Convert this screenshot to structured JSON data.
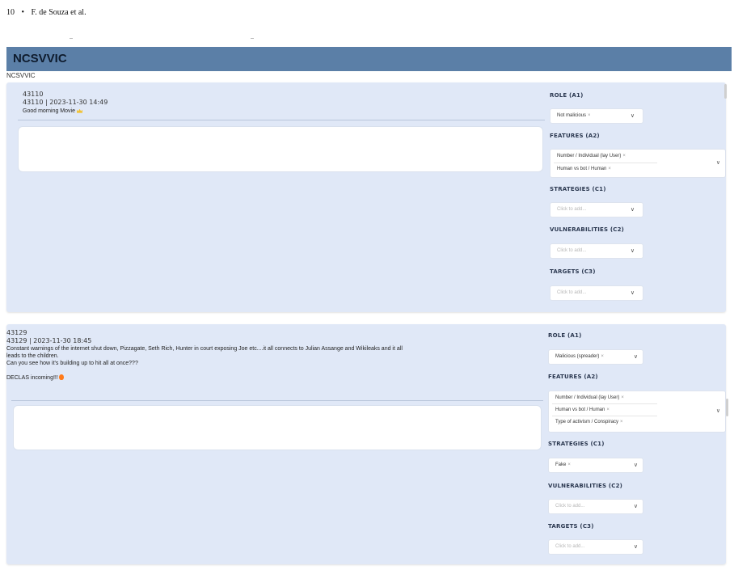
{
  "page_header": {
    "page_number": "10",
    "bullet": "•",
    "authors": "F. de Souza et al."
  },
  "app": {
    "title": "NCSVVIC",
    "subtitle": "NCSVVIC"
  },
  "field_labels": {
    "role": "ROLE (A1)",
    "features": "FEATURES (A2)",
    "strategies": "STRATEGIES (C1)",
    "vulnerabilities": "VULNERABILITIES (C2)",
    "targets": "TARGETS (C3)"
  },
  "placeholder": "Click to add...",
  "remove_glyph": "×",
  "chevron_glyph": "∨",
  "items": [
    {
      "id": "43110",
      "meta": "43110 | 2023-11-30 14:49",
      "text": "Good morning Movie",
      "comment": "",
      "role": "Not malicious",
      "features": [
        "Number / Individual (lay User)",
        "Human vs bot / Human"
      ],
      "strategies": [],
      "vulnerabilities": [],
      "targets": []
    },
    {
      "id": "43129",
      "meta": "43129 | 2023-11-30 18:45",
      "text": "Constant warnings of the internet shut down, Pizzagate, Seth Rich, Hunter in court exposing Joe etc....it all connects to Julian Assange and Wikileaks and it all\nleads to the children.\nCan you see how it's building up to hit all at once???\n\nDECLAS incoming!!!",
      "comment": "",
      "role": "Malicious (spreader)",
      "features": [
        "Number / Individual (lay User)",
        "Human vs bot / Human",
        "Type of activism / Conspiracy"
      ],
      "strategies": [
        "Fake"
      ],
      "vulnerabilities": [],
      "targets": []
    }
  ],
  "icons": {
    "item1_emoji": "crown-emoji-icon",
    "item2_emoji": "fire-emoji-icon"
  },
  "colors": {
    "banner": "#5b7fa7",
    "card": "#e0e8f7"
  }
}
